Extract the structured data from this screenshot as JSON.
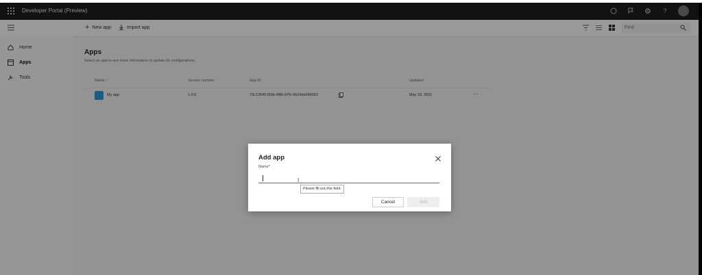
{
  "app": {
    "title": "Developer Portal (Preview)"
  },
  "toolbar": {
    "new_app": "New app",
    "import_app": "Import app",
    "search_placeholder": "Find"
  },
  "sidebar": {
    "items": [
      {
        "label": "Home",
        "icon": "home-icon"
      },
      {
        "label": "Apps",
        "icon": "apps-icon",
        "active": true
      },
      {
        "label": "Tools",
        "icon": "tools-icon"
      }
    ]
  },
  "main": {
    "title": "Apps",
    "subtitle": "Select an app to see more information or update its configurations.",
    "columns": [
      "Name",
      "Version number",
      "App ID",
      "Updated"
    ],
    "rows": [
      {
        "name": "My app",
        "version": "1.0.0",
        "app_id": "73c13645-f50b-4f86-87fc-0b19de066063",
        "updated": "May 18, 2021"
      }
    ],
    "sort_indicator": "↑"
  },
  "dialog": {
    "title": "Add app",
    "name_label": "Name*",
    "name_value": "",
    "tooltip": "Please fill out this field.",
    "cancel_label": "Cancel",
    "add_label": "Add"
  },
  "colors": {
    "accent": "#6264a7",
    "topbar": "#1f1f1f"
  }
}
